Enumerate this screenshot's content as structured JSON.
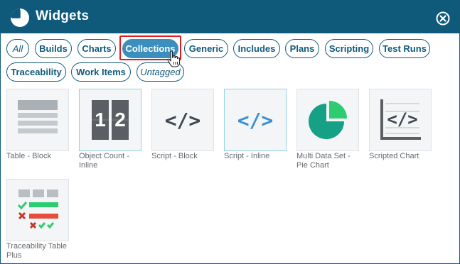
{
  "header": {
    "title": "Widgets",
    "icons": {
      "logo": "pie-logo-icon",
      "close": "close-circle-icon"
    }
  },
  "filters": [
    {
      "label": "All",
      "style": "italic"
    },
    {
      "label": "Builds"
    },
    {
      "label": "Charts"
    },
    {
      "label": "Collections",
      "active": true
    },
    {
      "label": "Generic"
    },
    {
      "label": "Includes"
    },
    {
      "label": "Plans"
    },
    {
      "label": "Scripting"
    },
    {
      "label": "Test Runs"
    },
    {
      "label": "Traceability"
    },
    {
      "label": "Work Items"
    },
    {
      "label": "Untagged",
      "style": "italic"
    }
  ],
  "widgets": [
    {
      "line1": "Table - Block",
      "line2": "",
      "icon": "table-block-icon"
    },
    {
      "line1": "Object Count -",
      "line2": "Inline",
      "icon": "object-count-icon",
      "digits": [
        "1",
        "2"
      ]
    },
    {
      "line1": "Script - Block",
      "line2": "",
      "icon": "code-brackets-icon",
      "code": "</>"
    },
    {
      "line1": "Script - Inline",
      "line2": "",
      "icon": "code-brackets-blue-icon",
      "code": "</>"
    },
    {
      "line1": "Multi Data Set -",
      "line2": "Pie Chart",
      "icon": "pie-chart-icon"
    },
    {
      "line1": "Scripted Chart",
      "line2": "",
      "icon": "scripted-chart-icon",
      "code": "</>"
    },
    {
      "line1": "Traceability Table",
      "line2": "Plus",
      "icon": "traceability-table-icon"
    }
  ],
  "colors": {
    "header": "#0f5a7b",
    "active_chip": "#3c8fbd",
    "highlight": "#e02020",
    "green": "#2ecc71",
    "red": "#e74c3c",
    "pie": "#16a085"
  }
}
